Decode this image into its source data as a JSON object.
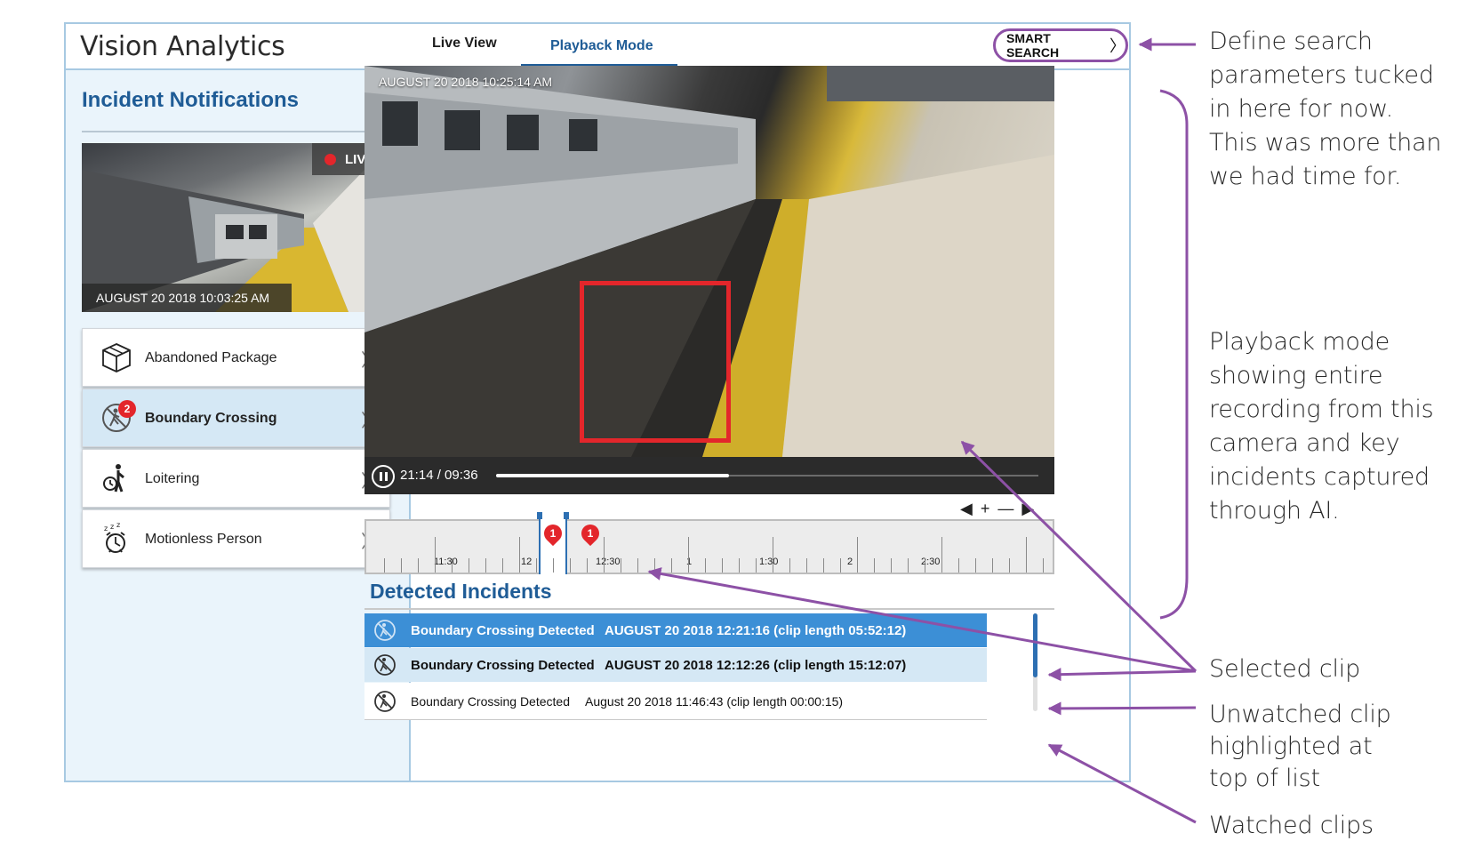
{
  "app": {
    "title": "Vision Analytics",
    "tabs": [
      {
        "label": "Live View",
        "active": false
      },
      {
        "label": "Playback Mode",
        "active": true
      }
    ],
    "smart_search_label": "SMART SEARCH"
  },
  "notifications": {
    "title": "Incident Notifications",
    "close_icon": "close-icon",
    "live_feed": {
      "badge": "LIVE",
      "timestamp": "AUGUST 20 2018 10:03:25 AM"
    },
    "incidents": [
      {
        "label": "Abandoned Package",
        "icon": "package-icon",
        "selected": false
      },
      {
        "label": "Boundary Crossing",
        "icon": "boundary-crossing-icon",
        "selected": true,
        "badge": "2"
      },
      {
        "label": "Loitering",
        "icon": "loitering-icon",
        "selected": false
      },
      {
        "label": "Motionless Person",
        "icon": "motionless-person-icon",
        "selected": false
      }
    ]
  },
  "player": {
    "timestamp": "AUGUST 20 2018 10:25:14 AM",
    "play_time": "21:14 / 09:36",
    "progress": 0.43
  },
  "timeline": {
    "labels": [
      "11:30",
      "12",
      "12:30",
      "1",
      "1:30",
      "2",
      "2:30"
    ],
    "markers": [
      "1",
      "1"
    ],
    "nav": [
      "◀",
      "+",
      "—",
      "▶"
    ]
  },
  "detected": {
    "title": "Detected Incidents",
    "rows": [
      {
        "name": "Boundary Crossing Detected",
        "detail": "AUGUST 20 2018 12:21:16 (clip length 05:52:12)",
        "state": "selected"
      },
      {
        "name": "Boundary Crossing Detected",
        "detail": "AUGUST 20 2018 12:12:26 (clip length 15:12:07)",
        "state": "unwatched"
      },
      {
        "name": "Boundary Crossing Detected",
        "detail": "August 20 2018 11:46:43 (clip length 00:00:15)",
        "state": "watched"
      }
    ]
  },
  "annotations": {
    "search": [
      "Define search",
      "parameters tucked",
      "in here for now.",
      "This was more than",
      "we had time for."
    ],
    "playback": [
      "Playback mode",
      "showing entire",
      "recording from this",
      "camera and key",
      "incidents captured",
      "through AI."
    ],
    "selected": "Selected clip",
    "unwatched": [
      "Unwatched clip",
      "highlighted at",
      "top of list"
    ],
    "watched": "Watched clips"
  },
  "colors": {
    "brand_blue": "#1f5c96",
    "selected_row": "#3c8fd6",
    "unwatched_row": "#d5e8f5",
    "alert_red": "#e3262b",
    "annotation_purple": "#8d51a6"
  }
}
